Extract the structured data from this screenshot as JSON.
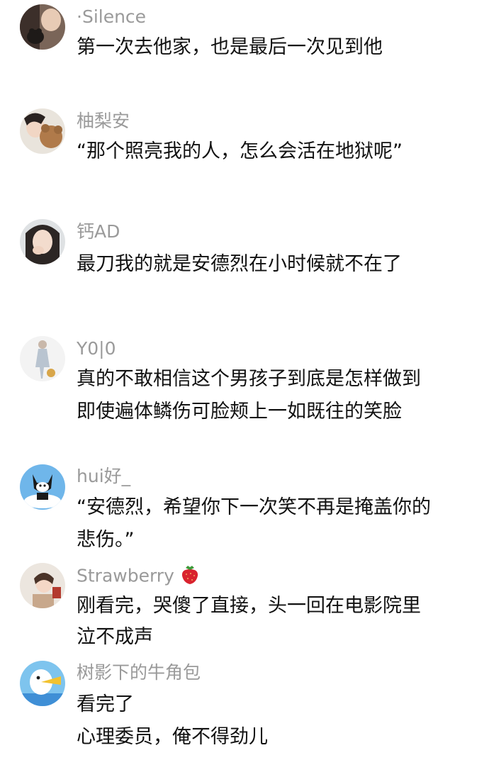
{
  "comments": [
    {
      "username": "·Silence",
      "lines": [
        "第一次去他家，也是最后一次见到他"
      ],
      "avatar_icon": "user-avatar-icon"
    },
    {
      "username": "柚梨安",
      "lines": [
        "“那个照亮我的人，怎么会活在地狱呢”"
      ],
      "avatar_icon": "user-avatar-icon"
    },
    {
      "username": "钙AD",
      "lines": [
        "最刀我的就是安德烈在小时候就不在了"
      ],
      "avatar_icon": "user-avatar-icon"
    },
    {
      "username": "Y0|0",
      "lines": [
        "真的不敢相信这个男孩子到底是怎样做到",
        "即使遍体鳞伤可脸颊上一如既往的笑脸"
      ],
      "avatar_icon": "user-avatar-icon"
    },
    {
      "username": "hui好_",
      "lines": [
        "“安德烈，希望你下一次笑不再是掩盖你的",
        "悲伤。”"
      ],
      "avatar_icon": "user-avatar-icon"
    },
    {
      "username": "Strawberry",
      "username_emoji": "strawberry-icon",
      "lines": [
        "刚看完，哭傻了直接，头一回在电影院里",
        "泣不成声"
      ],
      "avatar_icon": "user-avatar-icon"
    },
    {
      "username": "树影下的牛角包",
      "lines": [
        "看完了",
        "心理委员，俺不得劲儿"
      ],
      "avatar_icon": "user-avatar-icon"
    }
  ],
  "colors": {
    "background": "#ffffff",
    "username": "#9a9a9a",
    "body_text": "#111111",
    "strawberry": "#d9232e"
  }
}
